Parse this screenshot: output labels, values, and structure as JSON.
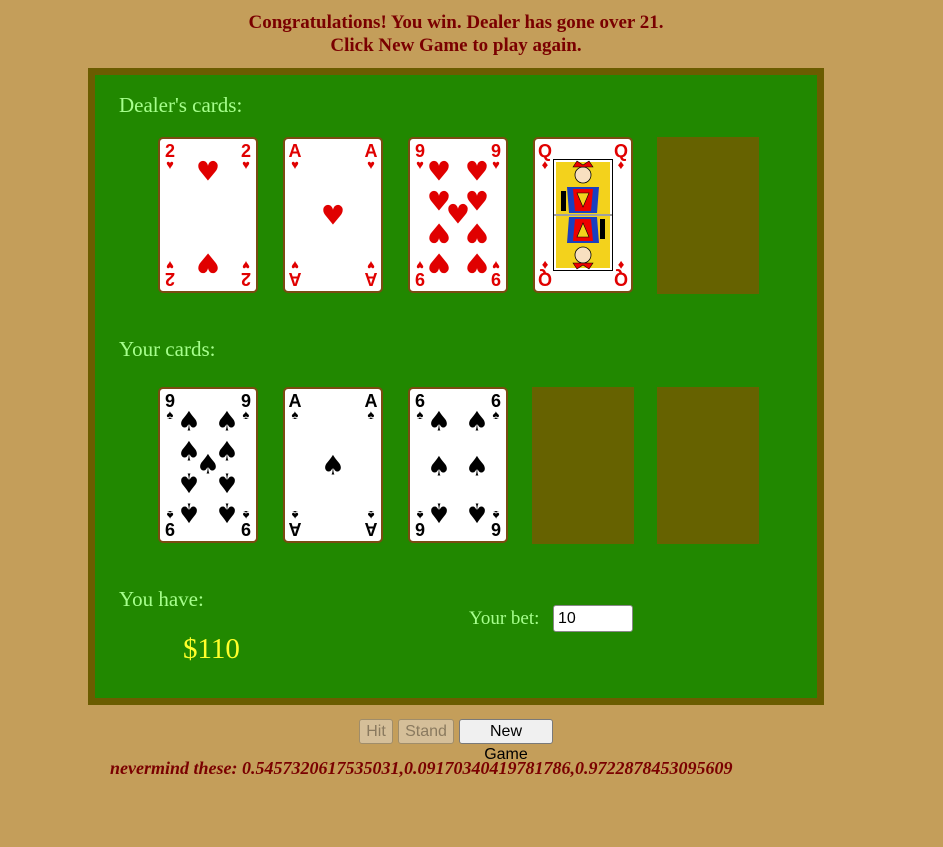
{
  "status": {
    "line1": "Congratulations! You win. Dealer has gone over 21.",
    "line2": "Click New Game to play again."
  },
  "dealer": {
    "label": "Dealer's cards:",
    "cards": [
      {
        "rank": "2",
        "suit": "hearts",
        "symbol": "♥"
      },
      {
        "rank": "A",
        "suit": "hearts",
        "symbol": "♥"
      },
      {
        "rank": "9",
        "suit": "hearts",
        "symbol": "♥"
      },
      {
        "rank": "Q",
        "suit": "diamonds",
        "symbol": "♦"
      }
    ],
    "empty_slots": 1
  },
  "player": {
    "label": "Your cards:",
    "cards": [
      {
        "rank": "9",
        "suit": "spades",
        "symbol": "♠"
      },
      {
        "rank": "A",
        "suit": "spades",
        "symbol": "♠"
      },
      {
        "rank": "6",
        "suit": "spades",
        "symbol": "♠"
      }
    ],
    "empty_slots": 2
  },
  "bank": {
    "label": "You have:",
    "amount": "$110"
  },
  "bet": {
    "label": "Your bet:",
    "value": "10"
  },
  "buttons": {
    "hit": "Hit",
    "hit_enabled": false,
    "stand": "Stand",
    "stand_enabled": false,
    "new_game": "New Game",
    "new_game_enabled": true
  },
  "footer": "nevermind these: 0.5457320617535031,0.09170340419781786,0.9722878453095609",
  "colors": {
    "page_bg": "#c49e5a",
    "table": "#218800",
    "table_border": "#6b5c00",
    "empty_slot": "#666200",
    "label": "#a6ff8c",
    "money": "#ffff2a",
    "message": "#7a0000"
  }
}
